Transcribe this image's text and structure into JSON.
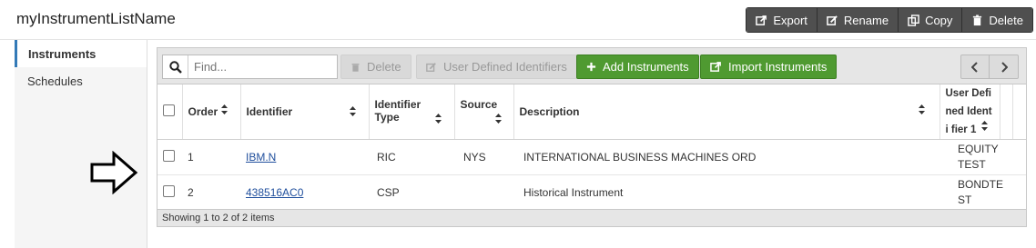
{
  "header": {
    "title": "myInstrumentListName",
    "actions": [
      {
        "label": "Export",
        "icon": "export-icon"
      },
      {
        "label": "Rename",
        "icon": "edit-icon"
      },
      {
        "label": "Copy",
        "icon": "copy-icon"
      },
      {
        "label": "Delete",
        "icon": "trash-icon"
      }
    ]
  },
  "nav": {
    "items": [
      {
        "label": "Instruments",
        "active": true
      },
      {
        "label": "Schedules",
        "active": false
      }
    ]
  },
  "toolbar": {
    "search_placeholder": "Find...",
    "delete_label": "Delete",
    "udi_label": "User Defined Identifiers",
    "add_label": "Add Instruments",
    "import_label": "Import Instruments"
  },
  "table": {
    "columns": {
      "order": "Order",
      "identifier": "Identifier",
      "identifier_type": "Identifier Type",
      "source": "Source",
      "description": "Description",
      "udi1": "User Defi ned Identi fier 1"
    },
    "rows": [
      {
        "order": "1",
        "identifier": "IBM.N",
        "identifier_type": "RIC",
        "source": "NYS",
        "description": "INTERNATIONAL BUSINESS MACHINES ORD",
        "udi1": "EQUITYTEST"
      },
      {
        "order": "2",
        "identifier": "438516AC0",
        "identifier_type": "CSP",
        "source": "",
        "description": "Historical Instrument",
        "udi1": "BONDTEST"
      }
    ]
  },
  "footer": {
    "status": "Showing 1 to 2 of 2 items"
  },
  "colors": {
    "accent": "#337ab7",
    "green": "#4f9a31",
    "dark_button": "#4f4f4f"
  }
}
